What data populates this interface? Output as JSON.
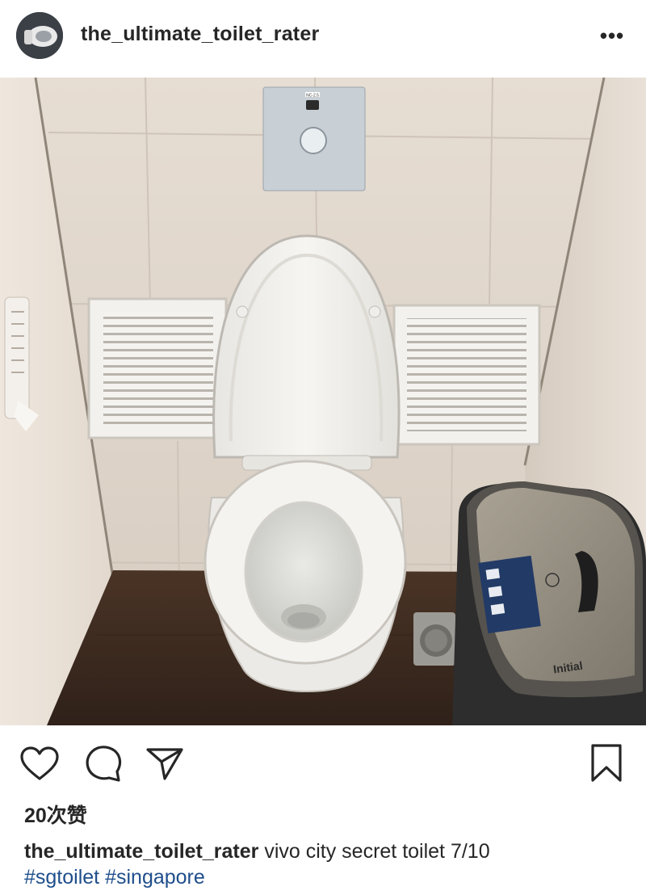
{
  "post": {
    "username": "the_ultimate_toilet_rater",
    "more_label": "•••",
    "photo": {
      "flush_plate_label": "NC-2.5",
      "bin_brand": "Initial"
    },
    "likes_text": "20次赞",
    "caption": {
      "username": "the_ultimate_toilet_rater",
      "text": " vivo city secret toilet 7/10",
      "hashtags": [
        "#sgtoilet",
        "#singapore"
      ]
    }
  },
  "icons": {
    "avatar": "toilet-avatar-icon",
    "like": "heart-icon",
    "comment": "comment-bubble-icon",
    "share": "paper-plane-icon",
    "save": "bookmark-icon",
    "more": "more-dots-icon"
  },
  "colors": {
    "text": "#262626",
    "hashtag": "#1f4e8c",
    "background": "#ffffff"
  }
}
